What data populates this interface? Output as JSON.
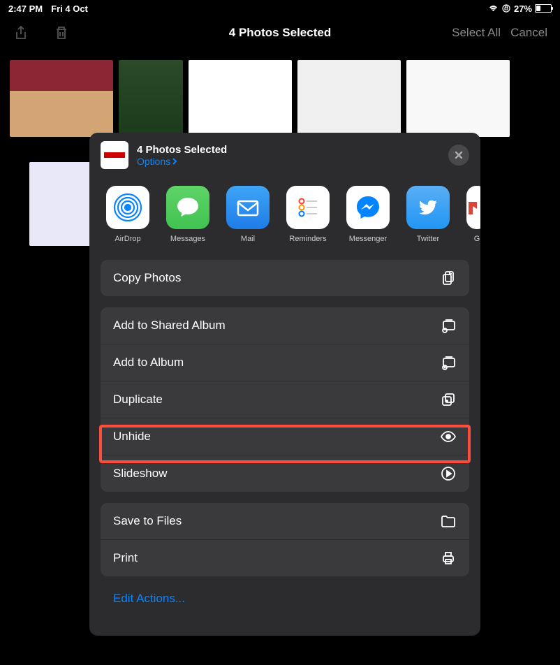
{
  "status": {
    "time": "2:47 PM",
    "date": "Fri 4 Oct",
    "battery_pct": "27%"
  },
  "nav": {
    "title": "4 Photos Selected",
    "select_all": "Select All",
    "cancel": "Cancel"
  },
  "sheet": {
    "title": "4 Photos Selected",
    "options": "Options",
    "apps": [
      {
        "id": "airdrop",
        "label": "AirDrop"
      },
      {
        "id": "messages",
        "label": "Messages"
      },
      {
        "id": "mail",
        "label": "Mail"
      },
      {
        "id": "reminders",
        "label": "Reminders"
      },
      {
        "id": "messenger",
        "label": "Messenger"
      },
      {
        "id": "twitter",
        "label": "Twitter"
      },
      {
        "id": "gmail",
        "label": "G"
      }
    ],
    "groups": [
      {
        "items": [
          {
            "id": "copy",
            "label": "Copy Photos"
          }
        ]
      },
      {
        "items": [
          {
            "id": "shared-album",
            "label": "Add to Shared Album"
          },
          {
            "id": "album",
            "label": "Add to Album"
          },
          {
            "id": "duplicate",
            "label": "Duplicate"
          },
          {
            "id": "unhide",
            "label": "Unhide",
            "highlighted": true
          },
          {
            "id": "slideshow",
            "label": "Slideshow"
          }
        ]
      },
      {
        "items": [
          {
            "id": "save-files",
            "label": "Save to Files"
          },
          {
            "id": "print",
            "label": "Print"
          }
        ]
      }
    ],
    "edit_actions": "Edit Actions..."
  }
}
